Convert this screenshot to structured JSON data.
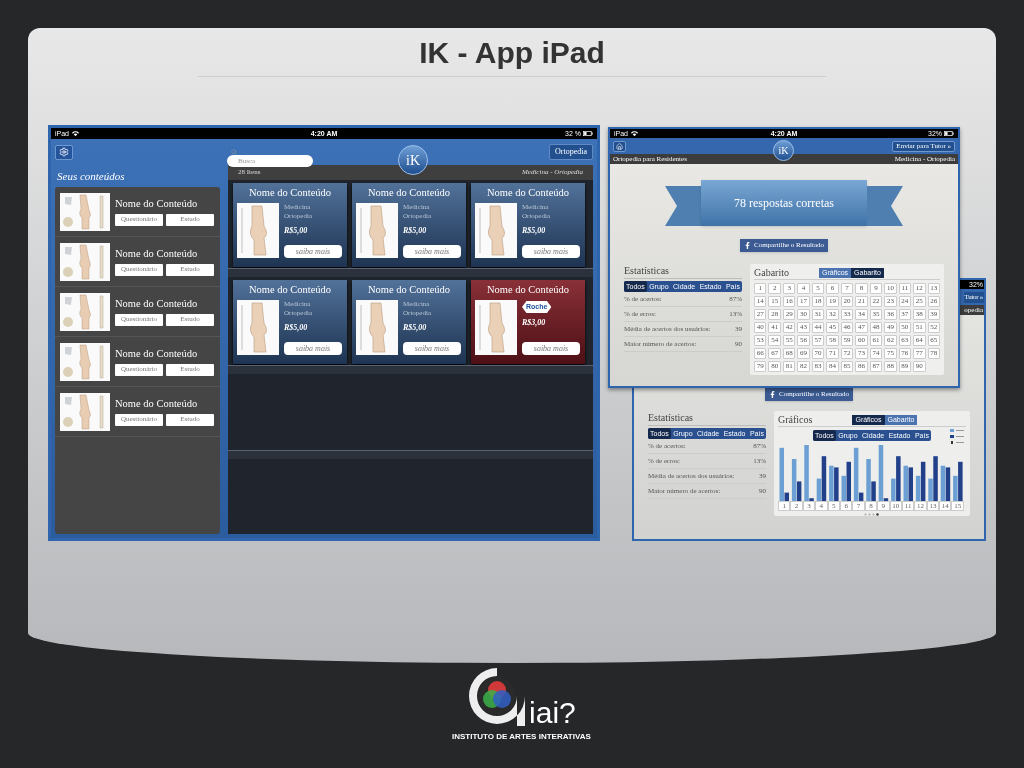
{
  "slide": {
    "title": "IK - App iPad"
  },
  "library_screen": {
    "status_bar": {
      "device": "iPad",
      "time": "4:20 AM",
      "battery": "32 %"
    },
    "search": {
      "placeholder": "Busca"
    },
    "logo": "iK",
    "category_button": "Ortopedia",
    "sidebar": {
      "title": "Seus conteúdos",
      "items": [
        {
          "title": "Nome do Conteúdo",
          "buttons": [
            "Questionário",
            "Estudo"
          ]
        },
        {
          "title": "Nome do Conteúdo",
          "buttons": [
            "Questionário",
            "Estudo"
          ]
        },
        {
          "title": "Nome do Conteúdo",
          "buttons": [
            "Questionário",
            "Estudo"
          ]
        },
        {
          "title": "Nome do Conteúdo",
          "buttons": [
            "Questionário",
            "Estudo"
          ]
        },
        {
          "title": "Nome do Conteúdo",
          "buttons": [
            "Questionário",
            "Estudo"
          ]
        }
      ]
    },
    "shelf": {
      "count": "28 Itens",
      "breadcrumb": "Medicina - Ortopedia",
      "rows": [
        {
          "cards": [
            {
              "kind": "standard",
              "title": "Nome do Conteúdo",
              "lines": [
                "Medicina",
                "Ortopedia"
              ],
              "price": "R$5,00",
              "button": "saiba mais"
            },
            {
              "kind": "standard",
              "title": "Nome do Conteúdo",
              "lines": [
                "Medicina",
                "Ortopedia"
              ],
              "price": "R$5,00",
              "button": "saiba mais"
            },
            {
              "kind": "standard",
              "title": "Nome do Conteúdo",
              "lines": [
                "Medicina",
                "Ortopedia"
              ],
              "price": "R$5,00",
              "button": "saiba mais"
            }
          ]
        },
        {
          "cards": [
            {
              "kind": "standard",
              "title": "Nome do Conteúdo",
              "lines": [
                "Medicina",
                "Ortopedia"
              ],
              "price": "R$5,00",
              "button": "saiba mais"
            },
            {
              "kind": "standard",
              "title": "Nome do Conteúdo",
              "lines": [
                "Medicina",
                "Ortopedia"
              ],
              "price": "R$5,00",
              "button": "saiba mais"
            },
            {
              "kind": "sponsored",
              "title": "Nome do Conteúdo",
              "sponsor": "Roche",
              "price": "R$3,00",
              "button": "saiba mais"
            }
          ]
        }
      ]
    }
  },
  "result_screen": {
    "status_bar": {
      "device": "iPad",
      "time": "4:20 AM",
      "battery": "32%"
    },
    "logo": "iK",
    "send_button": "Enviar para Tutor »",
    "course": "Ortopedia para Residentes",
    "breadcrumb": "Medicina - Ortopedia",
    "banner": "78 respostas corretas",
    "share_button": "Compartilhe o Resultado",
    "stats": {
      "title": "Estatísticas",
      "tabs": [
        {
          "label": "Todos",
          "selected": true
        },
        {
          "label": "Grupo",
          "selected": false
        },
        {
          "label": "Cidade",
          "selected": false
        },
        {
          "label": "Estado",
          "selected": false
        },
        {
          "label": "País",
          "selected": false
        }
      ],
      "rows": [
        {
          "label": "% de acertos:",
          "value": "87%"
        },
        {
          "label": "% de erros:",
          "value": "13%"
        },
        {
          "label": "Média de acertos dos usuários:",
          "value": "39"
        },
        {
          "label": "Maior número de acertos:",
          "value": "90"
        }
      ]
    },
    "answers": {
      "title": "Gabarito",
      "toggle": [
        {
          "label": "Gráficos",
          "selected": false
        },
        {
          "label": "Gabarito",
          "selected": true
        }
      ],
      "numbers": [
        "1",
        "2",
        "3",
        "4",
        "5",
        "6",
        "7",
        "8",
        "9",
        "10",
        "11",
        "12",
        "13",
        "14",
        "15",
        "16",
        "17",
        "18",
        "19",
        "20",
        "21",
        "22",
        "23",
        "24",
        "25",
        "26",
        "27",
        "28",
        "29",
        "30",
        "31",
        "32",
        "33",
        "34",
        "35",
        "36",
        "37",
        "38",
        "39",
        "40",
        "41",
        "42",
        "43",
        "44",
        "45",
        "46",
        "47",
        "48",
        "49",
        "50",
        "51",
        "52",
        "53",
        "54",
        "55",
        "56",
        "57",
        "58",
        "59",
        "60",
        "61",
        "62",
        "63",
        "64",
        "65",
        "66",
        "67",
        "68",
        "69",
        "70",
        "71",
        "72",
        "73",
        "74",
        "75",
        "76",
        "77",
        "78",
        "79",
        "80",
        "81",
        "82",
        "83",
        "84",
        "85",
        "86",
        "87",
        "88",
        "89",
        "90"
      ]
    }
  },
  "chart_screen": {
    "battery": "32%",
    "send_button": "Tutor »",
    "breadcrumb": "opedia",
    "share_button": "Compartilhe o Resultado",
    "stats": {
      "title": "Estatísticas",
      "tabs": [
        {
          "label": "Todos",
          "selected": true
        },
        {
          "label": "Grupo",
          "selected": false
        },
        {
          "label": "Cidade",
          "selected": false
        },
        {
          "label": "Estado",
          "selected": false
        },
        {
          "label": "País",
          "selected": false
        }
      ],
      "rows": [
        {
          "label": "% de acertos:",
          "value": "87%"
        },
        {
          "label": "% de erros:",
          "value": "13%"
        },
        {
          "label": "Média de acertos dos usuários:",
          "value": "39"
        },
        {
          "label": "Maior número de acertos:",
          "value": "90"
        }
      ]
    },
    "charts": {
      "title": "Gráficos",
      "toggle": [
        {
          "label": "Gráficos",
          "selected": true
        },
        {
          "label": "Gabarito",
          "selected": false
        }
      ],
      "tabs": [
        {
          "label": "Todos",
          "selected": true
        },
        {
          "label": "Grupo",
          "selected": false
        },
        {
          "label": "Cidade",
          "selected": false
        },
        {
          "label": "Estado",
          "selected": false
        },
        {
          "label": "País",
          "selected": false
        }
      ],
      "x_labels": [
        "1",
        "2",
        "3",
        "4",
        "5",
        "6",
        "7",
        "8",
        "9",
        "10",
        "11",
        "12",
        "13",
        "14",
        "15"
      ]
    }
  },
  "footer": {
    "logo_text": "iai?",
    "caption": "INSTITUTO DE ARTES INTERATIVAS"
  }
}
